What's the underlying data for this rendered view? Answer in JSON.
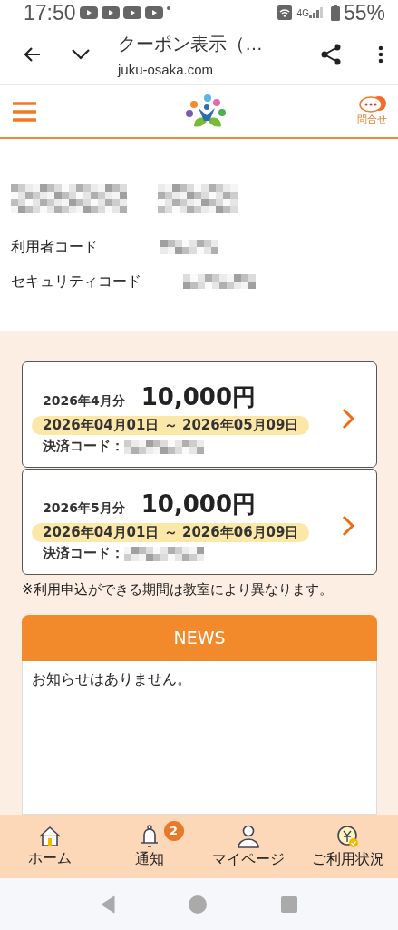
{
  "status_bar": {
    "time": "17:50",
    "network": "4G",
    "battery": "55%"
  },
  "browser": {
    "title": "クーポン表示（…",
    "url": "juku-osaka.com"
  },
  "header": {
    "contact_label": "問合せ"
  },
  "profile": {
    "fields": [
      {
        "label": "利用者コード"
      },
      {
        "label": "セキュリティコード"
      }
    ]
  },
  "coupons": [
    {
      "month": "2026年4月分",
      "amount": "10,000円",
      "period": "2026年04月01日 ～ 2026年05月09日",
      "code_label": "決済コード："
    },
    {
      "month": "2026年5月分",
      "amount": "10,000円",
      "period": "2026年04月01日 ～ 2026年06月09日",
      "code_label": "決済コード："
    }
  ],
  "note": "※利用申込ができる期間は教室により異なります。",
  "news": {
    "title": "NEWS",
    "message": "お知らせはありません。"
  },
  "bottom_nav": [
    {
      "kind": "home",
      "label": "ホーム"
    },
    {
      "kind": "bell",
      "label": "通知",
      "badge": "2"
    },
    {
      "kind": "person",
      "label": "マイページ"
    },
    {
      "kind": "coin",
      "label": "ご利用状況"
    }
  ]
}
